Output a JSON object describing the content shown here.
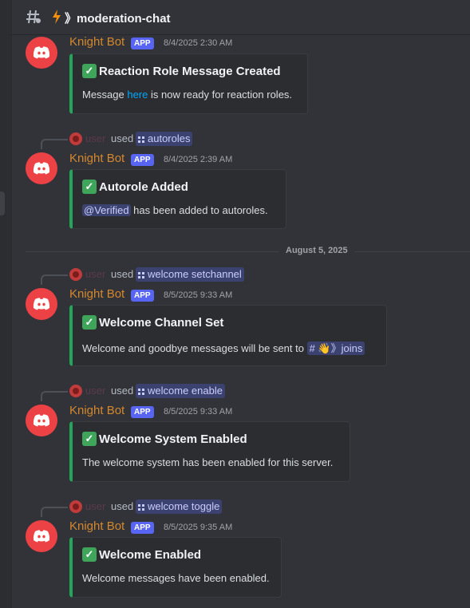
{
  "header": {
    "channel": "moderation-chat"
  },
  "divider": {
    "date": "August 5, 2025"
  },
  "bot": {
    "name": "Knight Bot",
    "tag": "APP"
  },
  "messages": [
    {
      "time": "8/4/2025 2:30 AM",
      "embed": {
        "title": "Reaction Role Message Created",
        "desc_pre": "Message ",
        "desc_link": "here",
        "desc_post": " is now ready for reaction roles."
      }
    },
    {
      "reply": {
        "user": "user",
        "used": "used",
        "command": "autoroles"
      },
      "time": "8/4/2025 2:39 AM",
      "embed": {
        "title": "Autorole Added",
        "mention": "@Verified",
        "desc_post": " has been added to autoroles."
      }
    },
    {
      "reply": {
        "user": "user",
        "used": "used",
        "command": "welcome setchannel"
      },
      "time": "8/5/2025 9:33 AM",
      "embed": {
        "title": "Welcome Channel Set",
        "desc_pre": "Welcome and goodbye messages will be sent to ",
        "channel_mention": "# 👋》joins"
      }
    },
    {
      "reply": {
        "user": "user",
        "used": "used",
        "command": "welcome enable"
      },
      "time": "8/5/2025 9:33 AM",
      "embed": {
        "title": "Welcome System Enabled",
        "desc_pre": "The welcome system has been enabled for this server."
      }
    },
    {
      "reply": {
        "user": "user",
        "used": "used",
        "command": "welcome toggle"
      },
      "time": "8/5/2025 9:35 AM",
      "embed": {
        "title": "Welcome Enabled",
        "desc_pre": "Welcome messages have been enabled."
      }
    }
  ],
  "icons": {
    "check": "✓"
  },
  "colors": {
    "accent": "#5865f2",
    "embed_border": "#23a55a",
    "bot_name": "#d4882c",
    "avatar": "#ed4245"
  }
}
